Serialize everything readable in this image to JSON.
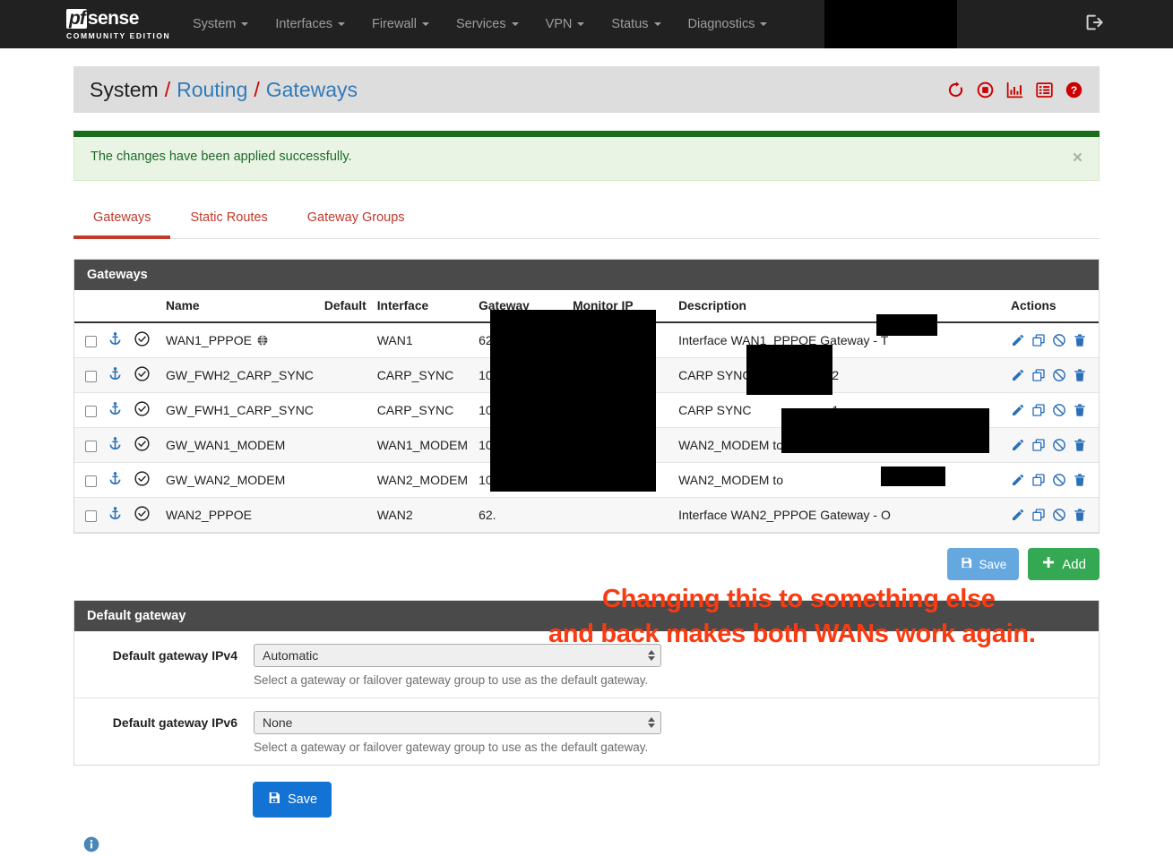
{
  "navbar": {
    "brand": {
      "pf": "pf",
      "sense": "sense",
      "subtitle": "COMMUNITY EDITION"
    },
    "menu": [
      {
        "label": "System"
      },
      {
        "label": "Interfaces"
      },
      {
        "label": "Firewall"
      },
      {
        "label": "Services"
      },
      {
        "label": "VPN"
      },
      {
        "label": "Status"
      },
      {
        "label": "Diagnostics"
      }
    ],
    "logout_icon": "logout-icon"
  },
  "header": {
    "breadcrumb": [
      {
        "text": "System",
        "link": false
      },
      {
        "text": "Routing",
        "link": true
      },
      {
        "text": "Gateways",
        "link": true
      }
    ],
    "separator": "/",
    "icons": [
      "restart-icon",
      "stop-icon",
      "chart-icon",
      "log-icon",
      "help-icon"
    ]
  },
  "alert": {
    "message": "The changes have been applied successfully.",
    "close_label": "×"
  },
  "tabs": [
    {
      "label": "Gateways",
      "active": true
    },
    {
      "label": "Static Routes",
      "active": false
    },
    {
      "label": "Gateway Groups",
      "active": false
    }
  ],
  "gateways_panel": {
    "title": "Gateways",
    "columns": [
      "",
      "",
      "",
      "Name",
      "Default",
      "Interface",
      "Gateway",
      "Monitor IP",
      "Description",
      "Actions"
    ],
    "rows": [
      {
        "name": "WAN1_PPPOE",
        "has_globe": true,
        "default": "",
        "interface": "WAN1",
        "gateway": "62.",
        "monitor": "",
        "description": "Interface WAN1_PPPOE Gateway - T"
      },
      {
        "name": "GW_FWH2_CARP_SYNC",
        "has_globe": false,
        "default": "",
        "interface": "CARP_SYNC",
        "gateway": "10.",
        "monitor": "",
        "description": "CARP SYNC ",
        "description_tail": "2"
      },
      {
        "name": "GW_FWH1_CARP_SYNC",
        "has_globe": false,
        "default": "",
        "interface": "CARP_SYNC",
        "gateway": "10.",
        "monitor": "",
        "description": "CARP SYNC ",
        "description_tail": "1"
      },
      {
        "name": "GW_WAN1_MODEM",
        "has_globe": false,
        "default": "",
        "interface": "WAN1_MODEM",
        "gateway": "10.",
        "monitor": "",
        "description": "WAN2_MODEM to "
      },
      {
        "name": "GW_WAN2_MODEM",
        "has_globe": false,
        "default": "",
        "interface": "WAN2_MODEM",
        "gateway": "10.",
        "monitor": "",
        "description": "WAN2_MODEM to "
      },
      {
        "name": "WAN2_PPPOE",
        "has_globe": false,
        "default": "",
        "interface": "WAN2",
        "gateway": "62.",
        "monitor": "",
        "description": "Interface WAN2_PPPOE Gateway - O"
      }
    ],
    "row_icons": {
      "select": "checkbox",
      "anchor": "anchor-icon",
      "status": "status-ok-icon",
      "globe": "globe-icon"
    },
    "action_icons": [
      "edit-icon",
      "copy-icon",
      "disable-icon",
      "delete-icon"
    ],
    "save_label": "Save",
    "add_label": "Add"
  },
  "default_gateway_panel": {
    "title": "Default gateway",
    "ipv4": {
      "label": "Default gateway IPv4",
      "value": "Automatic",
      "help": "Select a gateway or failover gateway group to use as the default gateway."
    },
    "ipv6": {
      "label": "Default gateway IPv6",
      "value": "None",
      "help": "Select a gateway or failover gateway group to use as the default gateway."
    }
  },
  "footer": {
    "save_label": "Save",
    "info_icon": "info-icon"
  },
  "annotation": {
    "line1": "Changing this to something else",
    "line2": "and back makes both WANs work again.",
    "color": "#f93b12"
  },
  "colors": {
    "navbar_bg": "#212121",
    "accent_red": "#c0392b",
    "link_blue": "#337ab7",
    "action_blue": "#2a6fb8",
    "success_green": "#1a6d1a",
    "add_green": "#34a853",
    "save_blue": "#1273d4"
  }
}
